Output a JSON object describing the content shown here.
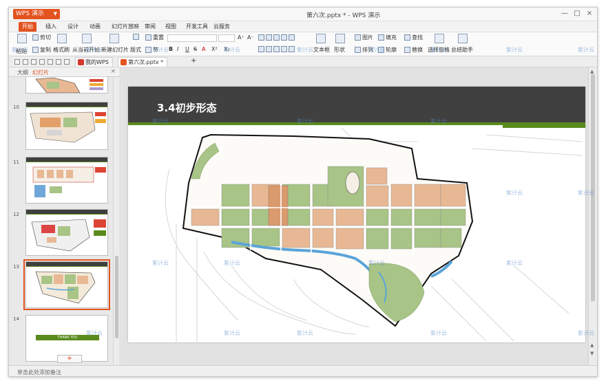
{
  "window": {
    "app_button": "WPS 演示",
    "doc_title": "第六次.pptx * - WPS 演示",
    "controls": [
      "—",
      "□",
      "×"
    ]
  },
  "ribbon_tabs": [
    "开始",
    "插入",
    "设计",
    "动画",
    "幻灯片放映",
    "审阅",
    "视图",
    "开发工具",
    "云服务"
  ],
  "ribbon": {
    "paste": "粘贴",
    "cut": "剪切",
    "copy": "复制",
    "format_painter": "格式刷",
    "from_current": "从当前开始",
    "new_slide": "新建幻灯片",
    "layout": "版式",
    "reset": "重置",
    "section": "节",
    "text_box": "文本框",
    "shape": "形状",
    "picture": "图片",
    "arrange": "排列",
    "fill": "填充",
    "outline": "轮廓",
    "find": "查找",
    "replace": "替换",
    "select_pane": "选择窗格",
    "assistant": "总结助手",
    "font_grow": "A⁺",
    "font_shrink": "A⁻",
    "bold": "B",
    "italic": "I",
    "underline": "U",
    "strike": "S",
    "superscript": "X²",
    "subscript": "X₂"
  },
  "doc_tabs": [
    {
      "label": "我的WPS",
      "active": false
    },
    {
      "label": "第六次.pptx *",
      "active": true
    }
  ],
  "left_panel": {
    "tabs": [
      "大纲",
      "幻灯片"
    ],
    "active_tab": "幻灯片",
    "slides": [
      {
        "num": "",
        "label": ""
      },
      {
        "num": "10",
        "label": ""
      },
      {
        "num": "11",
        "label": ""
      },
      {
        "num": "12",
        "label": ""
      },
      {
        "num": "13",
        "label": ""
      },
      {
        "num": "14",
        "label": "THANK YOU"
      }
    ],
    "add_button": "+"
  },
  "slide": {
    "title": "3.4初步形态"
  },
  "notes_placeholder": "单击此处添加备注",
  "watermark": "紫计云",
  "colors": {
    "accent": "#e3531f",
    "slide_header": "#404040",
    "slide_green": "#5a8a1d",
    "map_green": "#a8c486",
    "map_orange": "#e8b894",
    "map_water": "#5aa4d8"
  }
}
